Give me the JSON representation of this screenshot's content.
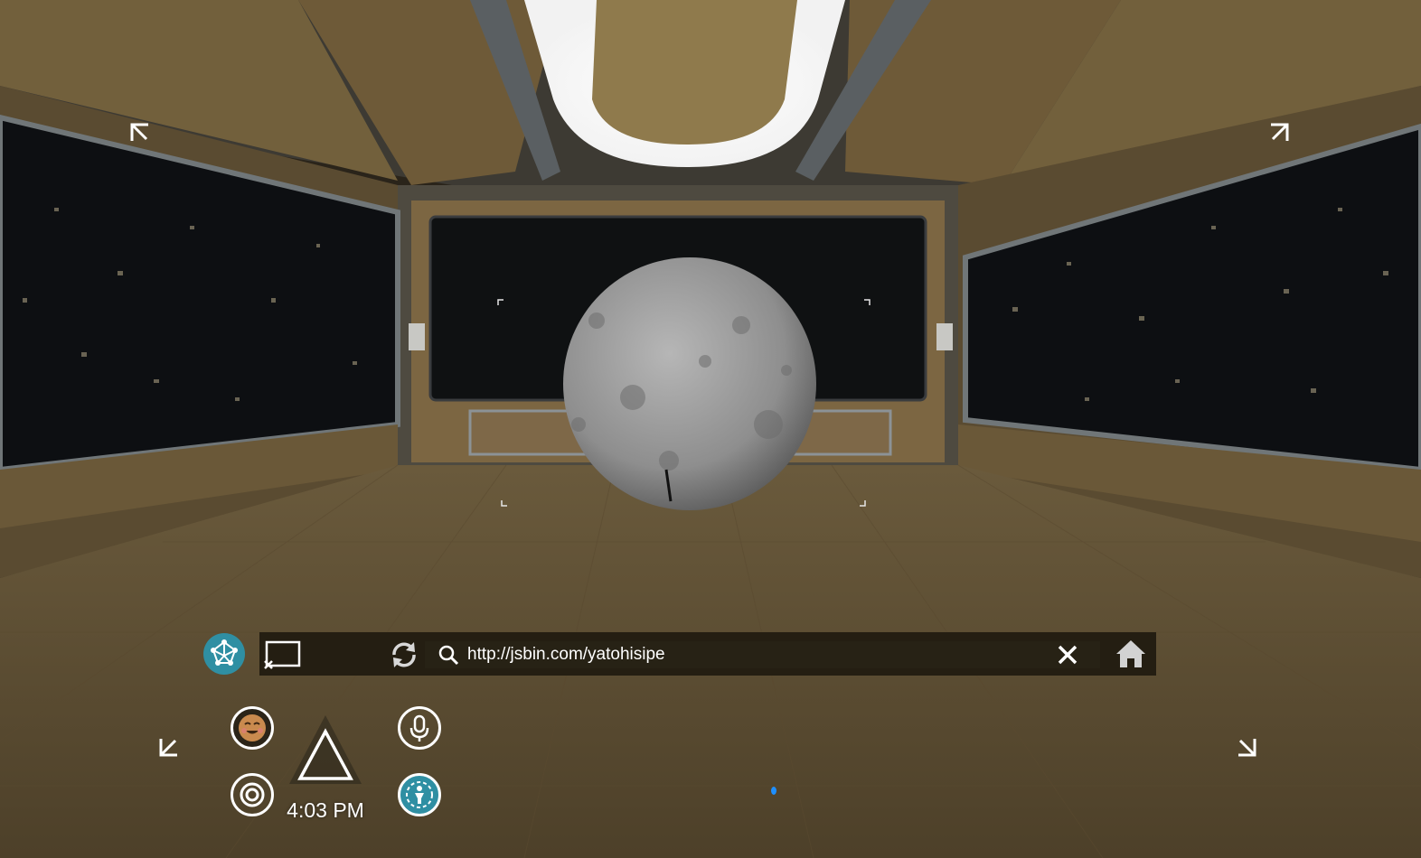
{
  "browser": {
    "url": "http://jsbin.com/yatohisipe",
    "clock": "4:03 PM"
  },
  "icons": {
    "app_menu": "network-icon",
    "cast": "cast-icon",
    "reload": "reload-icon",
    "search": "search-icon",
    "clear": "close-icon",
    "home": "home-icon",
    "emoji": "emoji-icon",
    "camera": "camera-icon",
    "voice": "microphone-icon",
    "avatar": "avatar-icon",
    "back": "triangle-back-icon"
  },
  "colors": {
    "accent": "#2f8fa3",
    "bar": "#1c180e",
    "text": "#ffffff",
    "cursor": "#1e8fff"
  }
}
